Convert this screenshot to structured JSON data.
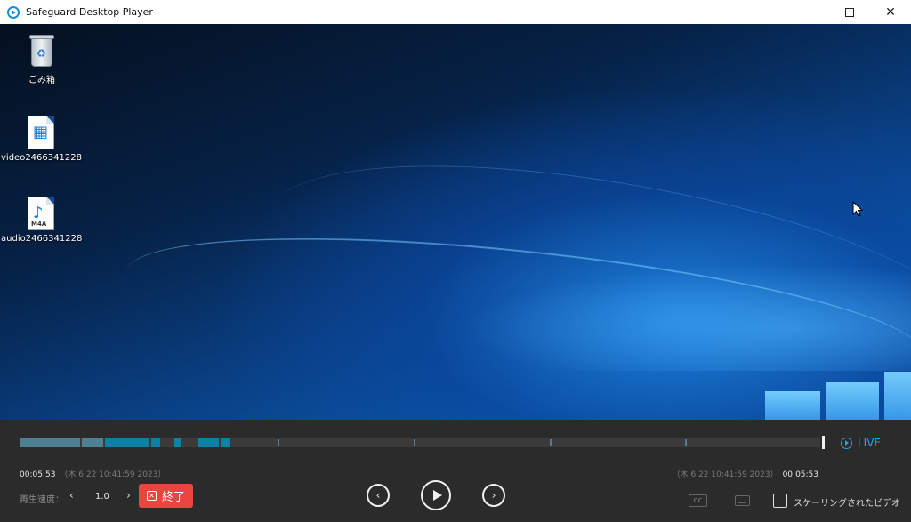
{
  "window": {
    "title": "Safeguard Desktop Player",
    "icons": {
      "app": "play-circle-icon",
      "minimize": "minimize-icon",
      "maximize": "maximize-icon",
      "close": "close-icon"
    }
  },
  "desktop": {
    "icons": [
      {
        "label": "ごみ箱",
        "icon": "recycle-bin-icon"
      },
      {
        "label": "video2466341228",
        "icon": "video-file-icon"
      },
      {
        "label": "audio2466341228",
        "icon": "audio-file-icon",
        "tag": "M4A"
      }
    ]
  },
  "timeline": {
    "live_label": "LIVE",
    "accent": "#1a8fd6",
    "recorded_color": "#0e7fa8"
  },
  "playback": {
    "current_time": "00:05:53",
    "current_datetime": "（木 6 22 10:41:59 2023）",
    "end_datetime": "（木 6 22 10:41:59 2023）",
    "end_time": "00:05:53",
    "speed_label": "再生速度：",
    "speed_value": "1.0",
    "speed_prev": "‹",
    "speed_next": "›",
    "end_button": "終了",
    "end_button_color": "#e8463f",
    "cc_label": "CC",
    "scaling_label": "スケーリングされたビデオ",
    "scaling_checked": false
  }
}
